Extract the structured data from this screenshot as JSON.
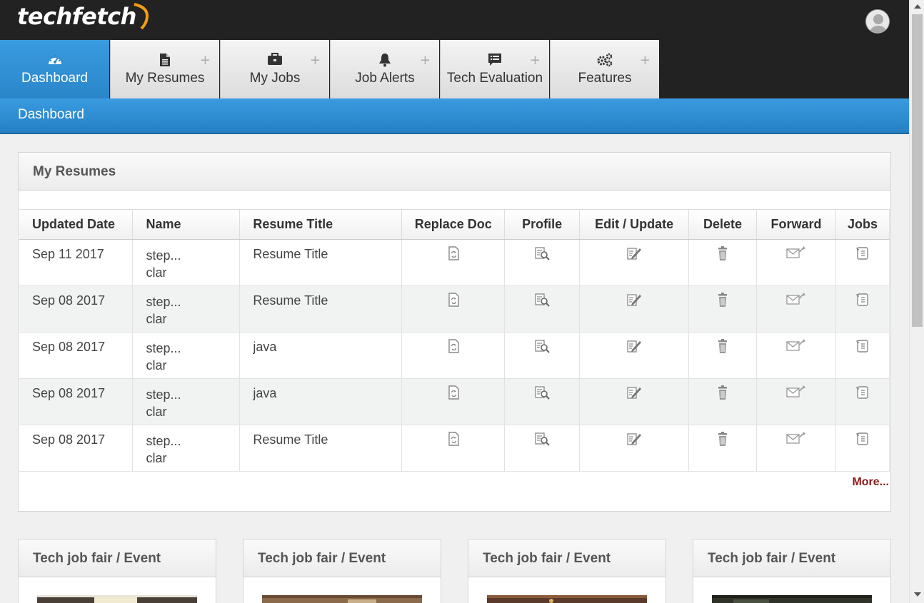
{
  "app": {
    "logo_text": "techfetch",
    "accent_color": "#2a86c9",
    "brand_orange": "#f39c12"
  },
  "tabs": [
    {
      "label": "Dashboard",
      "icon": "dashboard-icon",
      "active": true
    },
    {
      "label": "My Resumes",
      "icon": "document-icon",
      "plus": "+"
    },
    {
      "label": "My Jobs",
      "icon": "briefcase-icon",
      "plus": "+"
    },
    {
      "label": "Job Alerts",
      "icon": "bell-icon",
      "plus": "+"
    },
    {
      "label": "Tech Evaluation",
      "icon": "chat-icon",
      "plus": "+"
    },
    {
      "label": "Features",
      "icon": "gears-icon",
      "plus": "+"
    }
  ],
  "subbar": {
    "title": "Dashboard"
  },
  "resumes": {
    "title": "My Resumes",
    "columns": [
      "Updated Date",
      "Name",
      "Resume Title",
      "Replace Doc",
      "Profile",
      "Edit / Update",
      "Delete",
      "Forward",
      "Jobs"
    ],
    "rows": [
      {
        "date": "Sep 11 2017",
        "name1": "step...",
        "name2": "clar",
        "title": "Resume Title"
      },
      {
        "date": "Sep 08 2017",
        "name1": "step...",
        "name2": "clar",
        "title": "Resume Title"
      },
      {
        "date": "Sep 08 2017",
        "name1": "step...",
        "name2": "clar",
        "title": "java"
      },
      {
        "date": "Sep 08 2017",
        "name1": "step...",
        "name2": "clar",
        "title": "java"
      },
      {
        "date": "Sep 08 2017",
        "name1": "step...",
        "name2": "clar",
        "title": "Resume Title"
      }
    ],
    "more_label": "More..."
  },
  "events": [
    {
      "title": "Tech job fair / Event"
    },
    {
      "title": "Tech job fair / Event"
    },
    {
      "title": "Tech job fair / Event"
    },
    {
      "title": "Tech job fair / Event"
    }
  ]
}
